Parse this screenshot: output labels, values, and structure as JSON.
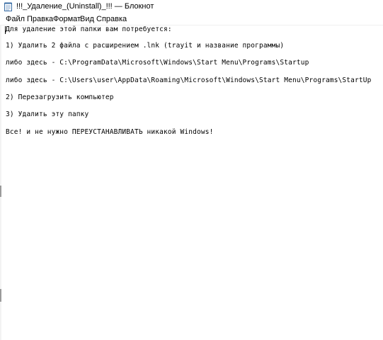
{
  "window": {
    "title": "!!!_Удаление_(Uninstall)_!!! — Блокнот"
  },
  "menu": {
    "items": [
      "Файл",
      "Правка",
      "Формат",
      "Вид",
      "Справка"
    ]
  },
  "document": {
    "lines": [
      "Для удаление этой папки вам потребуется:",
      "1) Удалить 2 файла с расширением .lnk (trayit и название программы)",
      "либо здесь - C:\\ProgramData\\Microsoft\\Windows\\Start Menu\\Programs\\Startup",
      "либо здесь - C:\\Users\\user\\AppData\\Roaming\\Microsoft\\Windows\\Start Menu\\Programs\\StartUp",
      "2) Перезагрузить компьютер",
      "3) Удалить эту папку",
      "Все! и не нужно ПЕРЕУСТАНАВЛИВАТЬ никакой Windows!"
    ]
  },
  "icons": {
    "app": "notepad-icon"
  },
  "colors": {
    "background": "#ffffff",
    "text": "#000000"
  }
}
